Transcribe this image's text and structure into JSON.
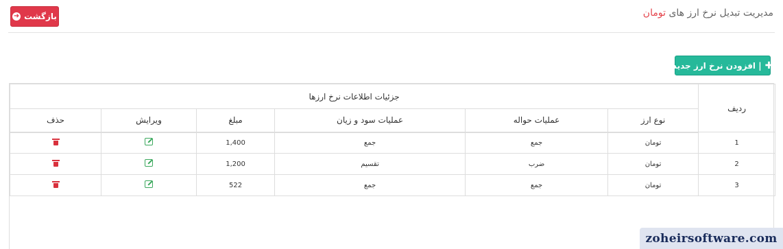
{
  "header": {
    "title": "مدیریت تبدیل نرخ ارز های",
    "title_accent": "تومان",
    "back_label": "بازگشت"
  },
  "toolbar": {
    "add_label": "| افزودن نرخ ارز جدید"
  },
  "table": {
    "header_row": "ردیف",
    "group_header": "جزئیات اطلاعات نرخ ارزها",
    "columns": {
      "currency": "نوع ارز",
      "transfer_op": "عملیات حواله",
      "profit_op": "عملیات سود و زیان",
      "amount": "مبلغ",
      "edit": "ویرایش",
      "delete": "حذف"
    },
    "rows": [
      {
        "index": "1",
        "currency": "تومان",
        "transfer_op": "جمع",
        "profit_op": "جمع",
        "amount": "1,400"
      },
      {
        "index": "2",
        "currency": "تومان",
        "transfer_op": "ضرب",
        "profit_op": "تقسیم",
        "amount": "1,200"
      },
      {
        "index": "3",
        "currency": "تومان",
        "transfer_op": "جمع",
        "profit_op": "جمع",
        "amount": "522"
      }
    ]
  },
  "watermark": "zoheirsoftware.com",
  "colors": {
    "danger": "#e0384a",
    "success": "#26b99a",
    "edit_icon": "#3aa85c",
    "delete_icon": "#d9313d"
  },
  "icons": {
    "back": "arrow-circle-left-icon",
    "add": "plus-icon",
    "edit": "edit-icon",
    "delete": "trash-icon"
  }
}
